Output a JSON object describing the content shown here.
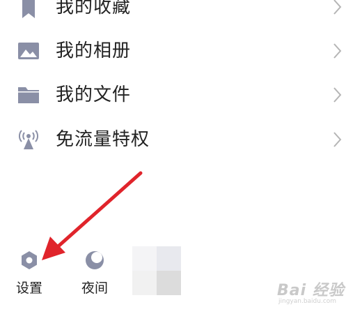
{
  "menu": {
    "items": [
      {
        "label": "我的收藏",
        "icon": "bookmark-icon"
      },
      {
        "label": "我的相册",
        "icon": "photo-icon"
      },
      {
        "label": "我的文件",
        "icon": "folder-icon"
      },
      {
        "label": "免流量特权",
        "icon": "signal-tower-icon"
      }
    ]
  },
  "bottom_bar": {
    "settings_label": "设置",
    "night_label": "夜间"
  },
  "watermark": {
    "text": "Bai 经验",
    "url": "jingyan.baidu.com"
  },
  "colors": {
    "icon": "#8a8fa6",
    "text": "#222222",
    "chevron": "#b5b5b5",
    "arrow": "#e0242b"
  }
}
